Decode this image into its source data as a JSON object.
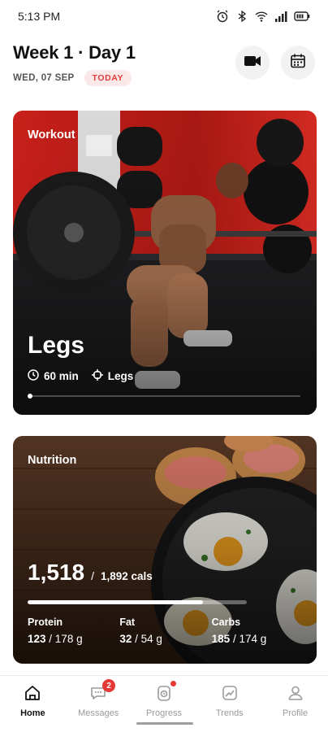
{
  "status_bar": {
    "time": "5:13 PM",
    "icons": [
      "alarm-icon",
      "bluetooth-icon",
      "wifi-icon",
      "signal-icon",
      "battery-icon"
    ]
  },
  "header": {
    "title": "Week 1 · Day 1",
    "date": "WED, 07 SEP",
    "today_badge": "TODAY",
    "actions": [
      "video-camera-icon",
      "calendar-icon"
    ]
  },
  "workout": {
    "label": "Workout",
    "title": "Legs",
    "duration": "60 min",
    "focus": "Legs"
  },
  "nutrition": {
    "label": "Nutrition",
    "calories_consumed": "1,518",
    "separator": "/",
    "calories_target": "1,892 cals",
    "progress": 0.8,
    "macros": [
      {
        "label": "Protein",
        "value": "123",
        "target": "/ 178 g"
      },
      {
        "label": "Fat",
        "value": "32",
        "target": "/ 54 g"
      },
      {
        "label": "Carbs",
        "value": "185",
        "target": "/ 174 g"
      }
    ]
  },
  "nav": {
    "items": [
      {
        "label": "Home",
        "icon": "home-icon",
        "active": true
      },
      {
        "label": "Messages",
        "icon": "chat-icon",
        "badge": "2"
      },
      {
        "label": "Progress",
        "icon": "progress-icon",
        "dot": true
      },
      {
        "label": "Trends",
        "icon": "trends-icon"
      },
      {
        "label": "Profile",
        "icon": "profile-icon"
      }
    ]
  },
  "colors": {
    "accent": "#e23b3b",
    "badge_bg": "#fbe9ea"
  }
}
